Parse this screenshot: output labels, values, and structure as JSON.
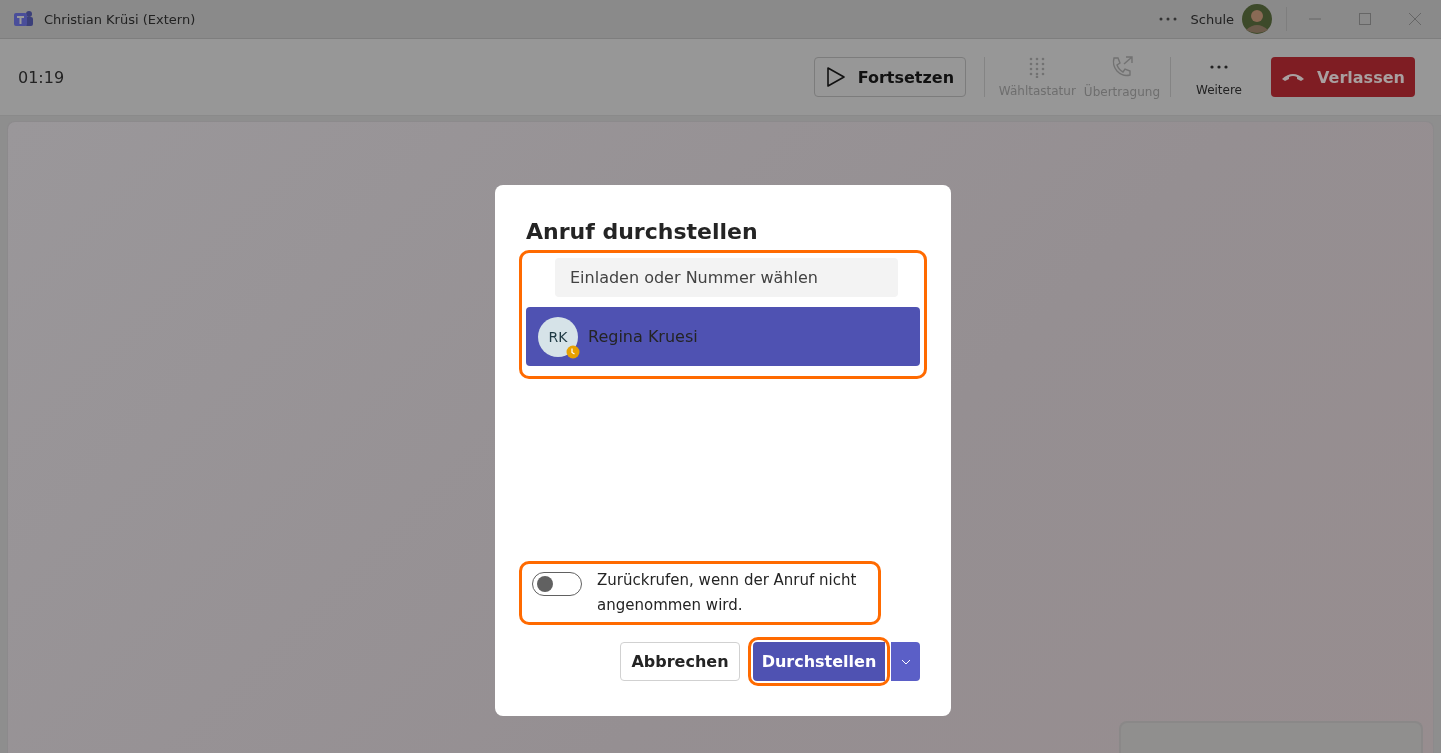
{
  "window": {
    "title": "Christian Krüsi (Extern)",
    "account": "Schule"
  },
  "toolbar": {
    "timer": "01:19",
    "actions": [
      {
        "kind": "resume",
        "label": "Fortsetzen"
      },
      {
        "kind": "dialpad",
        "label": "Wähltastatur",
        "disabled": true
      },
      {
        "kind": "transfer",
        "label": "Übertragung",
        "disabled": true
      },
      {
        "kind": "more",
        "label": "Weitere"
      },
      {
        "kind": "leave",
        "label": "Verlassen"
      }
    ]
  },
  "dialog": {
    "title": "Anruf durchstellen",
    "search": {
      "placeholder": "Einladen oder Nummer wählen"
    },
    "results": [
      {
        "initials": "RK",
        "name": "Regina Kruesi",
        "selected": true
      }
    ],
    "toggle": {
      "label": "Zurückrufen, wenn der Anruf nicht angenommen wird.",
      "on": false
    },
    "buttons": [
      {
        "kind": "secondary",
        "label": "Abbrechen"
      },
      {
        "kind": "primary",
        "label": "Durchstellen"
      }
    ]
  }
}
